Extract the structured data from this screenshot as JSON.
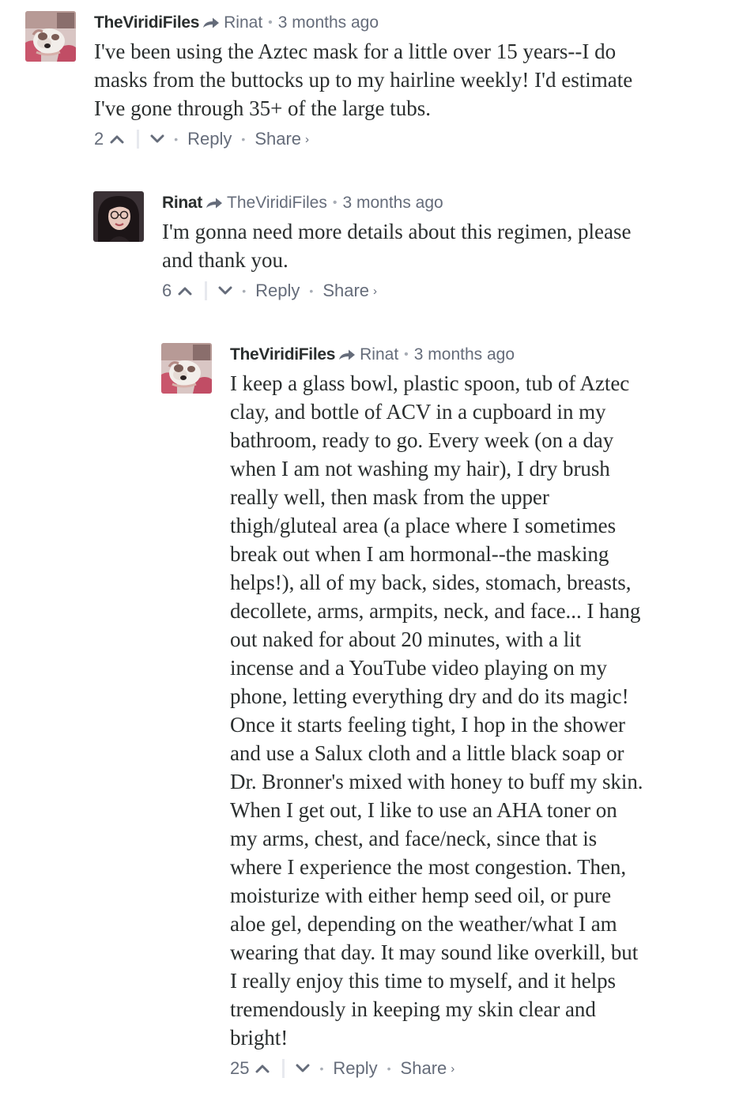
{
  "comments": [
    {
      "author": "TheViridiFiles",
      "avatar_icon": "bulldog-avatar",
      "reply_to": "Rinat",
      "time": "3 months ago",
      "text": "I've been using the Aztec mask for a little over 15 years--I do\nmasks from the buttocks up to my hairline weekly! I'd estimate\nI've gone through 35+ of the large tubs.",
      "votes": "2",
      "reply_label": "Reply",
      "share_label": "Share"
    },
    {
      "author": "Rinat",
      "avatar_icon": "woman-avatar",
      "reply_to": "TheViridiFiles",
      "time": "3 months ago",
      "text": "I'm gonna need more details about this regimen, please\nand thank you.",
      "votes": "6",
      "reply_label": "Reply",
      "share_label": "Share"
    },
    {
      "author": "TheViridiFiles",
      "avatar_icon": "bulldog-avatar",
      "reply_to": "Rinat",
      "time": "3 months ago",
      "text": "I keep a glass bowl, plastic spoon, tub of Aztec\nclay, and bottle of ACV in a cupboard in my\nbathroom, ready to go. Every week (on a day\nwhen I am not washing my hair), I dry brush\nreally well, then mask from the upper\nthigh/gluteal area (a place where I sometimes\nbreak out when I am hormonal--the masking\nhelps!), all of my back, sides, stomach, breasts,\ndecollete, arms, armpits, neck, and face... I hang\nout naked for about 20 minutes, with a lit\nincense and a YouTube video playing on my\nphone, letting everything dry and do its magic!\nOnce it starts feeling tight, I hop in the shower\nand use a Salux cloth and a little black soap or\nDr. Bronner's mixed with honey to buff my skin.\nWhen I get out, I like to use an AHA toner on\nmy arms, chest, and face/neck, since that is\nwhere I experience the most congestion. Then,\nmoisturize with either hemp seed oil, or pure\naloe gel, depending on the weather/what I am\nwearing that day. It may sound like overkill, but\nI really enjoy this time to myself, and it helps\ntremendously in keeping my skin clear and\nbright!",
      "votes": "25",
      "reply_label": "Reply",
      "share_label": "Share"
    }
  ],
  "colors": {
    "text": "#2a2e2e",
    "meta": "#656c7a",
    "bullet": "#a8adb5",
    "divider": "#e7e9ee"
  }
}
